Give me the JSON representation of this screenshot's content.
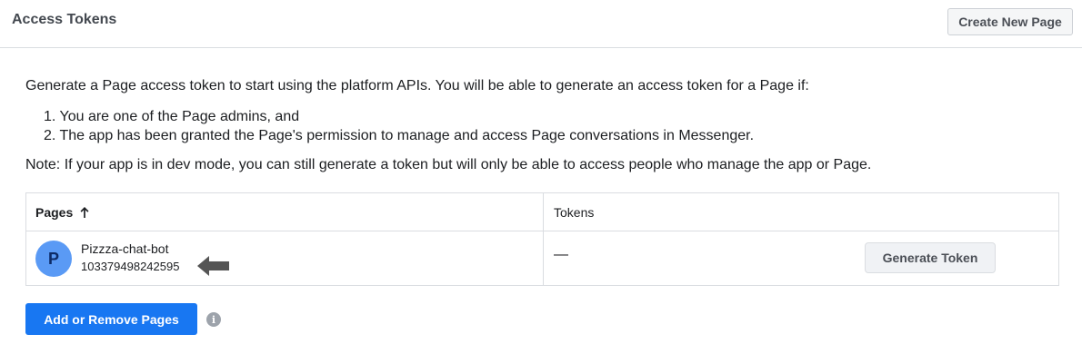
{
  "header": {
    "title": "Access Tokens",
    "create_button": "Create New Page"
  },
  "intro": {
    "description": "Generate a Page access token to start using the platform APIs. You will be able to generate an access token for a Page if:",
    "requirements": [
      "1. You are one of the Page admins, and",
      "2. The app has been granted the Page's permission to manage and access Page conversations in Messenger."
    ],
    "note": "Note: If your app is in dev mode, you can still generate a token but will only be able to access people who manage the app or Page."
  },
  "table": {
    "columns": [
      "Pages",
      "Tokens"
    ],
    "sort_icon": "arrow-up-icon",
    "rows": [
      {
        "avatar_letter": "P",
        "page_name": "Pizzza-chat-bot",
        "page_id": "103379498242595",
        "token": "—",
        "action": "Generate Token"
      }
    ]
  },
  "footer": {
    "add_button": "Add or Remove Pages",
    "info_icon": "info-icon"
  },
  "colors": {
    "primary": "#1877f2",
    "avatar": "#5a9af5",
    "border": "#dadde1"
  }
}
